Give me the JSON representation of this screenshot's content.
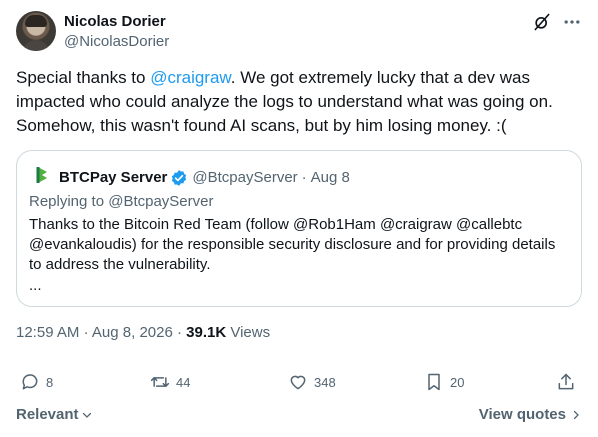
{
  "author": {
    "name": "Nicolas Dorier",
    "handle": "@NicolasDorier"
  },
  "tweet": {
    "text_before": "Special thanks to ",
    "mention": "@craigraw",
    "text_after": ". We got extremely lucky that a dev was impacted who could analyze the logs to understand what was going on. Somehow, this wasn't found AI scans, but by him losing money. :("
  },
  "quote": {
    "name": "BTCPay Server",
    "handle": "@BtcpayServer",
    "separator": "·",
    "date": "Aug 8",
    "replying_to": "Replying to @BtcpayServer",
    "text": "Thanks to the Bitcoin Red Team (follow @Rob1Ham @craigraw @callebtc @evankaloudis) for the responsible security disclosure and for providing details to address the vulnerability.",
    "more": "...",
    "logo_color": "#51b13e",
    "verified_color": "#1d9bf0"
  },
  "meta": {
    "time": "12:59 AM",
    "separator": "·",
    "date": "Aug 8, 2026",
    "views_count": "39.1K",
    "views_label": "Views"
  },
  "actions": {
    "replies": "8",
    "reposts": "44",
    "likes": "348",
    "bookmarks": "20"
  },
  "footer": {
    "relevant_label": "Relevant",
    "view_quotes_label": "View quotes"
  },
  "icons": {
    "top": [
      "grok-icon",
      "more-icon"
    ],
    "actions": [
      "reply-icon",
      "repost-icon",
      "like-icon",
      "bookmark-icon",
      "share-icon"
    ]
  }
}
